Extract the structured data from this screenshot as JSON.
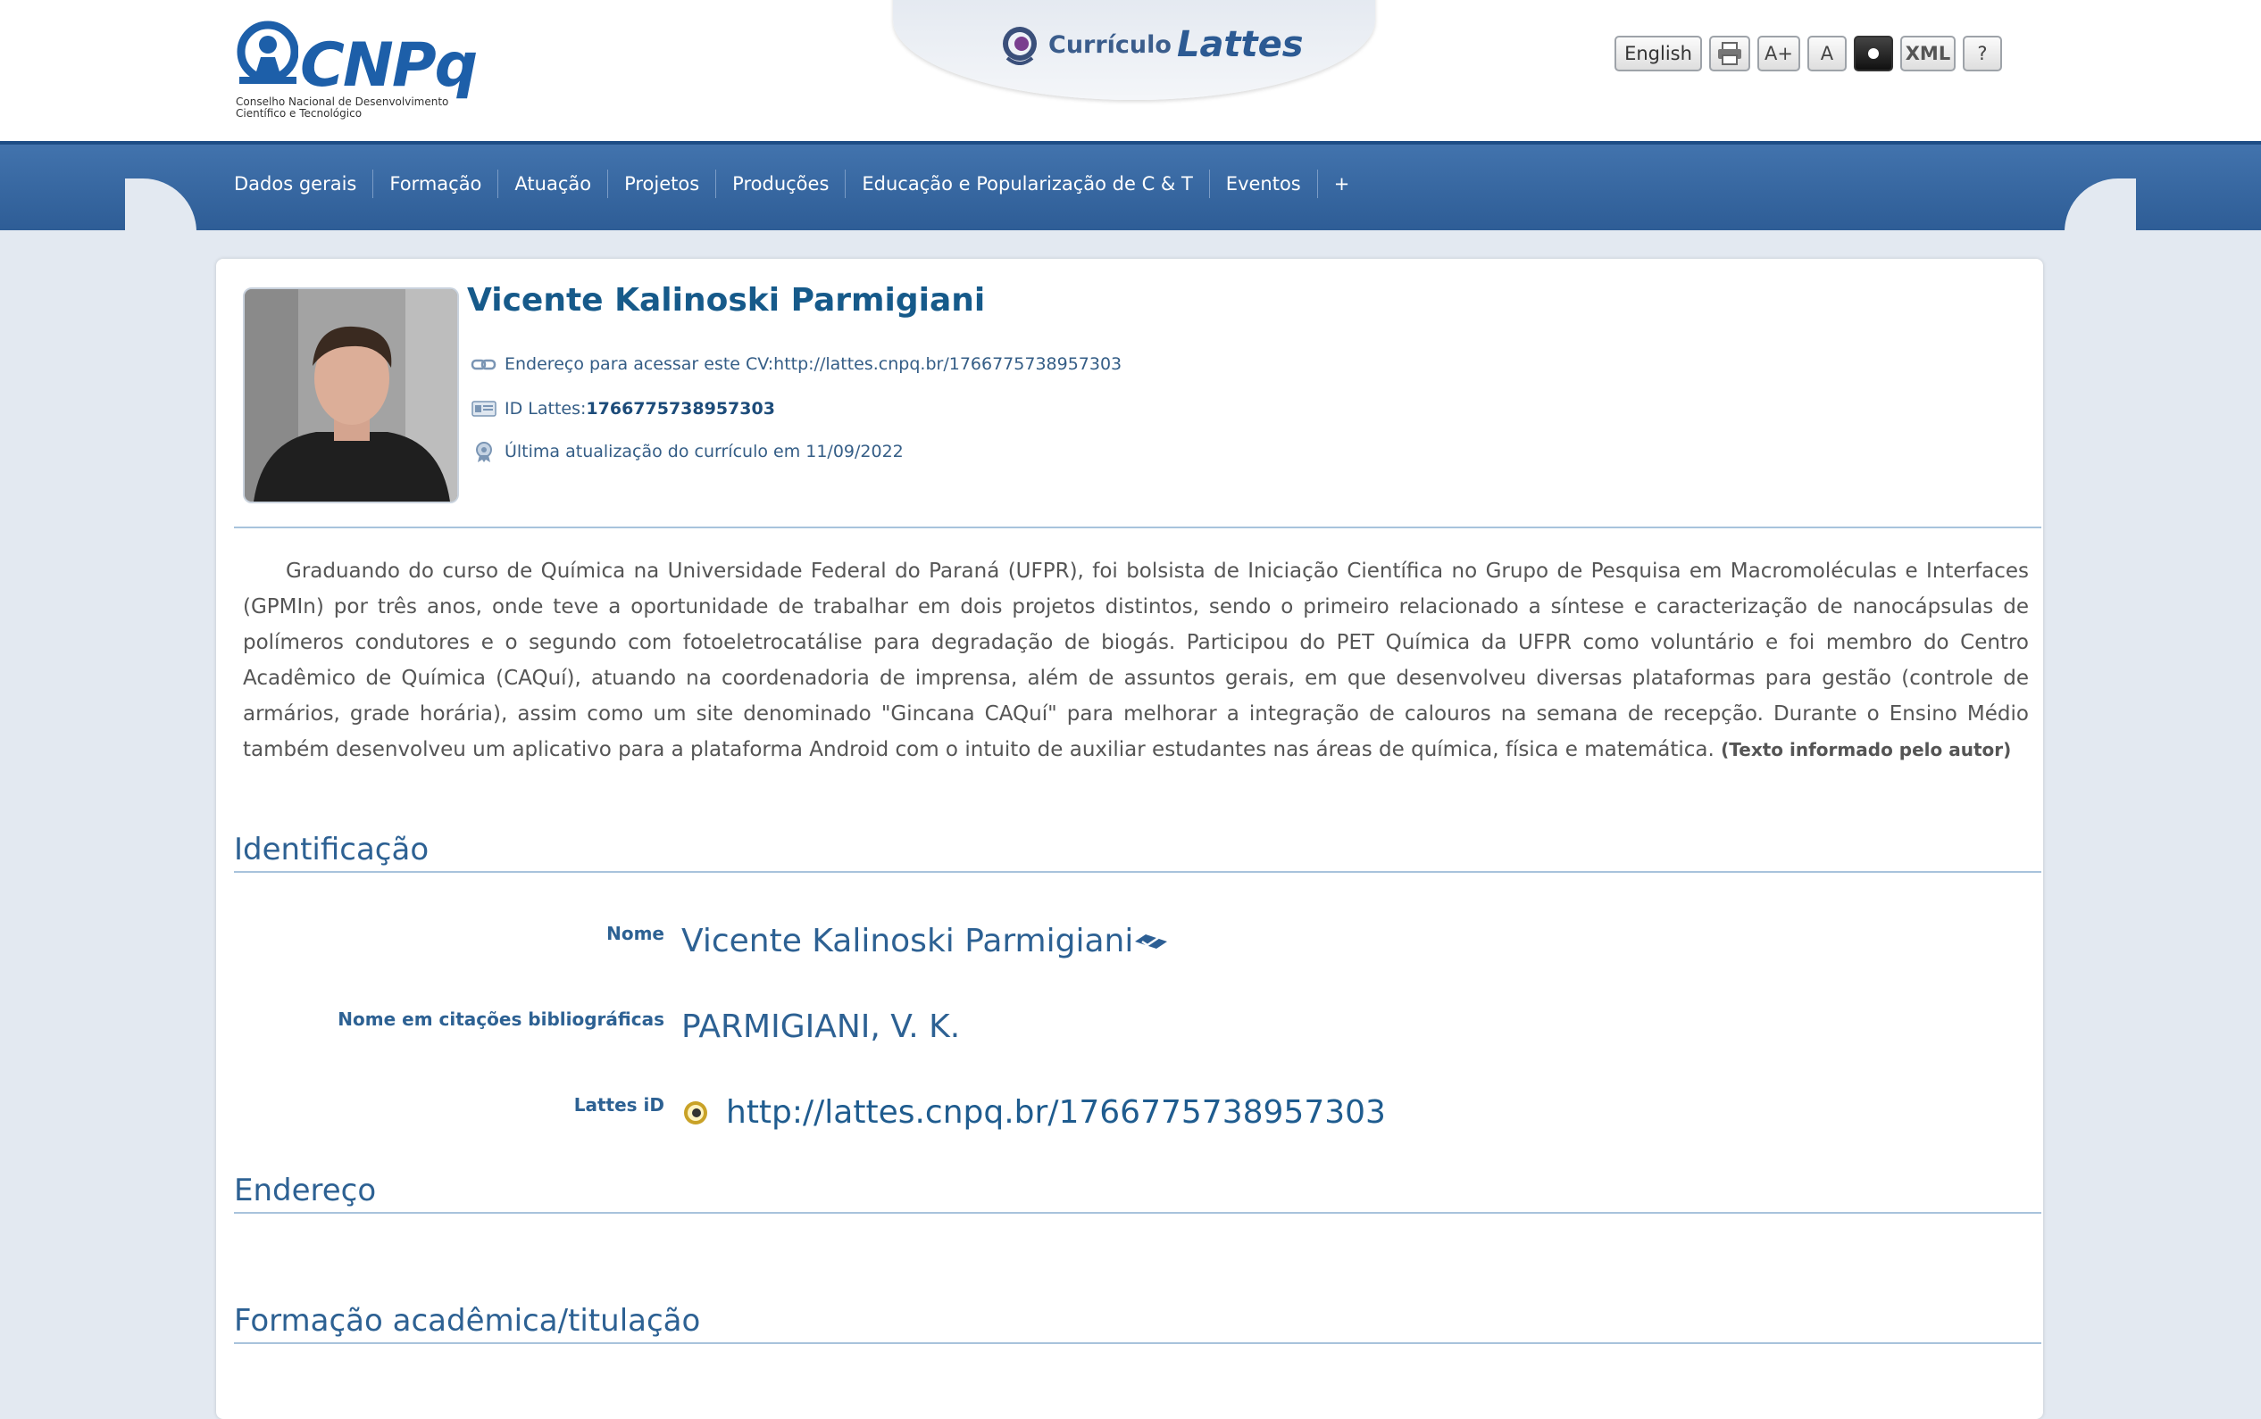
{
  "header": {
    "logo_text": "CNPq",
    "logo_sub": "Conselho Nacional de Desenvolvimento Científico e Tecnológico",
    "lattes_small": "Currículo",
    "lattes_big": "Lattes",
    "tools": {
      "english": "English",
      "font_up": "A+",
      "font_normal": "A",
      "xml": "XML",
      "help": "?"
    }
  },
  "nav": {
    "items": [
      "Dados gerais",
      "Formação",
      "Atuação",
      "Projetos",
      "Produções",
      "Educação e Popularização de C & T",
      "Eventos",
      "+"
    ]
  },
  "profile": {
    "name": "Vicente Kalinoski Parmigiani",
    "cv_address_label": "Endereço para acessar este CV: ",
    "cv_address": "http://lattes.cnpq.br/1766775738957303",
    "lattes_id_label": "ID Lattes: ",
    "lattes_id": "1766775738957303",
    "last_update": "Última atualização do currículo em 11/09/2022"
  },
  "resumo": {
    "text": "Graduando do curso de Química na Universidade Federal do Paraná (UFPR), foi bolsista de Iniciação Científica no Grupo de Pesquisa em Macromoléculas e Interfaces (GPMIn) por três anos, onde teve a oportunidade de trabalhar em dois projetos distintos, sendo o primeiro relacionado a síntese e caracterização de nanocápsulas de polímeros condutores e o segundo com fotoeletrocatálise para degradação de biogás. Participou do PET Química da UFPR como voluntário e foi membro do Centro Acadêmico de Química (CAQuí), atuando na coordenadoria de imprensa, além de assuntos gerais, em que desenvolveu diversas plataformas para gestão (controle de armários, grade horária), assim como um site denominado \"Gincana CAQuí\" para melhorar a integração de calouros na semana de recepção. Durante o Ensino Médio também desenvolveu um aplicativo para a plataforma Android com o intuito de auxiliar estudantes nas áreas de química, física e matemática. ",
    "author_note": "(Texto informado pelo autor)"
  },
  "identificacao": {
    "title": "Identificação",
    "nome_label": "Nome",
    "nome_value": "Vicente Kalinoski Parmigiani",
    "citacoes_label": "Nome em citações bibliográficas",
    "citacoes_value": "PARMIGIANI, V. K.",
    "lattes_label": "Lattes iD",
    "lattes_value": "http://lattes.cnpq.br/1766775738957303"
  },
  "sections": {
    "endereco": "Endereço",
    "formacao": "Formação acadêmica/titulação"
  },
  "colors": {
    "nav_blue": "#2e5d96",
    "heading_blue": "#2d6193",
    "page_bg": "#e3e9f1"
  }
}
